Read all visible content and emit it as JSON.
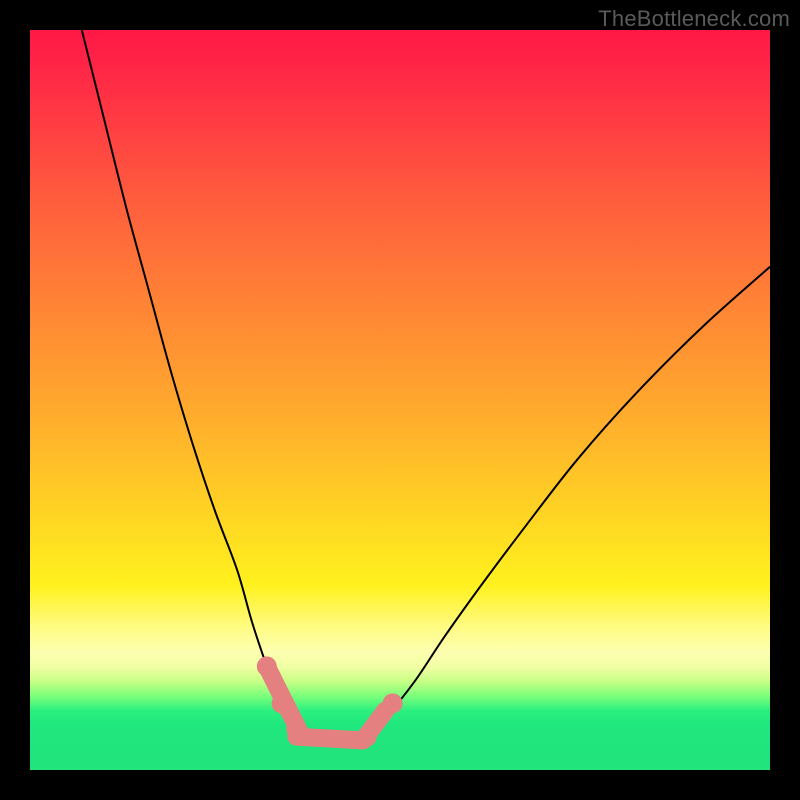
{
  "watermark": "TheBottleneck.com",
  "chart_data": {
    "type": "line",
    "title": "",
    "xlabel": "",
    "ylabel": "",
    "xlim": [
      0,
      100
    ],
    "ylim": [
      0,
      100
    ],
    "series": [
      {
        "name": "left-curve",
        "x": [
          7,
          10,
          13,
          16,
          19,
          22,
          25,
          28,
          30,
          32,
          33.5,
          35,
          36.5,
          38
        ],
        "y": [
          100,
          88,
          76,
          65,
          54,
          44,
          35,
          27,
          20,
          14,
          10,
          7,
          5,
          4
        ]
      },
      {
        "name": "right-curve",
        "x": [
          45,
          48,
          52,
          56,
          61,
          67,
          74,
          82,
          91,
          100
        ],
        "y": [
          4,
          7,
          12,
          18,
          25,
          33,
          42,
          51,
          60,
          68
        ]
      },
      {
        "name": "floor",
        "x": [
          38,
          40,
          42,
          44,
          45
        ],
        "y": [
          4,
          3.5,
          3.5,
          3.5,
          4
        ]
      }
    ],
    "markers": [
      {
        "name": "pink-thick-left",
        "kind": "segment",
        "x": [
          32,
          36.5
        ],
        "y": [
          14,
          5
        ]
      },
      {
        "name": "pink-thick-floor",
        "kind": "segment",
        "x": [
          36,
          45
        ],
        "y": [
          4.5,
          4
        ]
      },
      {
        "name": "pink-thick-right",
        "kind": "segment",
        "x": [
          45,
          48
        ],
        "y": [
          4,
          8
        ]
      },
      {
        "name": "pink-dot-1",
        "kind": "dot",
        "x": 32,
        "y": 14
      },
      {
        "name": "pink-dot-2",
        "kind": "dot",
        "x": 34,
        "y": 9
      },
      {
        "name": "pink-dot-3",
        "kind": "dot",
        "x": 36,
        "y": 5.5
      },
      {
        "name": "pink-dot-4",
        "kind": "dot",
        "x": 45.5,
        "y": 4.5
      },
      {
        "name": "pink-dot-5",
        "kind": "dot",
        "x": 49,
        "y": 9
      }
    ],
    "colors": {
      "curve": "#000000",
      "marker_stroke": "#e58080",
      "marker_fill": "#e58080"
    }
  }
}
